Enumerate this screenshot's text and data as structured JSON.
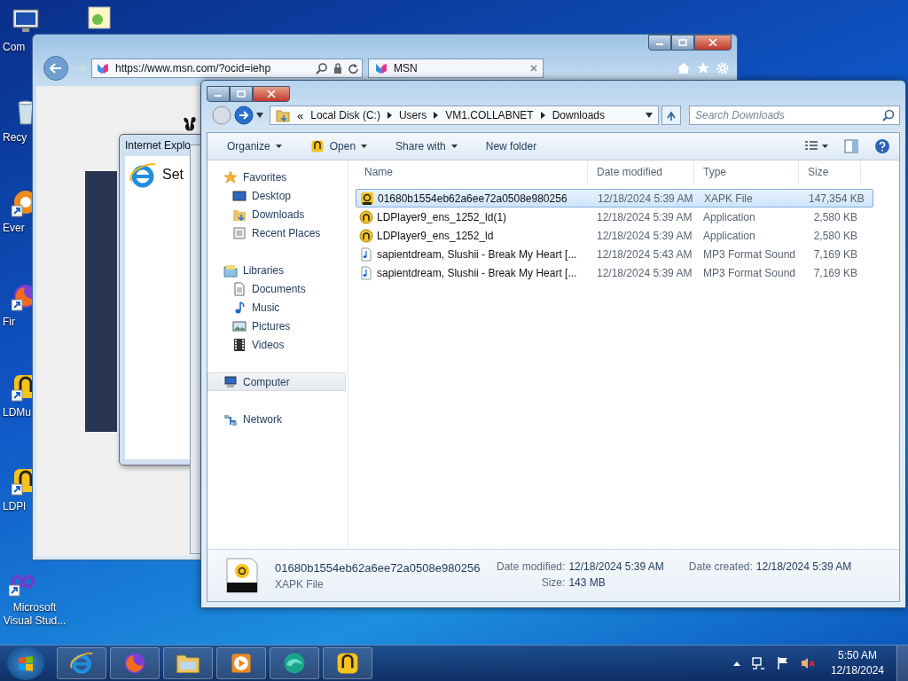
{
  "desktop_icons": [
    {
      "label": "Com"
    },
    {
      "label": "Recy"
    },
    {
      "label": "Ever"
    },
    {
      "label": "Fir"
    },
    {
      "label": "LDMu"
    },
    {
      "label": "LDPl"
    },
    {
      "label": "Microsoft Visual Stud..."
    }
  ],
  "browser": {
    "address": "https://www.msn.com/?ocid=iehp",
    "tab": "MSN",
    "dialog": {
      "title": "Internet Explo",
      "text": "Set"
    }
  },
  "explorer": {
    "breadcrumb_overflow": "«",
    "breadcrumb": [
      "Local Disk (C:)",
      "Users",
      "VM1.COLLABNET",
      "Downloads"
    ],
    "search": {
      "placeholder": "Search Downloads"
    },
    "toolbar": [
      {
        "label": "Organize",
        "kind": "menu"
      },
      {
        "label": "Open",
        "kind": "open"
      },
      {
        "label": "Share with",
        "kind": "menu"
      },
      {
        "label": "New folder",
        "kind": "plain"
      }
    ],
    "nav": [
      {
        "label": "Favorites",
        "selected": false,
        "children": [
          {
            "label": "Desktop",
            "selected": false
          },
          {
            "label": "Downloads",
            "selected": false
          },
          {
            "label": "Recent Places",
            "selected": false
          }
        ]
      },
      {
        "label": "Libraries",
        "selected": false,
        "children": [
          {
            "label": "Documents",
            "selected": false
          },
          {
            "label": "Music",
            "selected": false
          },
          {
            "label": "Pictures",
            "selected": false
          },
          {
            "label": "Videos",
            "selected": false
          }
        ]
      },
      {
        "label": "Computer",
        "selected": true
      },
      {
        "label": "Network",
        "selected": false
      }
    ],
    "columns": [
      "Name",
      "Date modified",
      "Type",
      "Size"
    ],
    "rows": [
      {
        "kind": "xapk",
        "name": "01680b1554eb62a6ee72a0508e980256",
        "date": "12/18/2024 5:39 AM",
        "type": "XAPK File",
        "size": "147,354 KB",
        "selected": true
      },
      {
        "kind": "app",
        "name": "LDPlayer9_ens_1252_ld(1)",
        "date": "12/18/2024 5:39 AM",
        "type": "Application",
        "size": "2,580 KB",
        "selected": false
      },
      {
        "kind": "app",
        "name": "LDPlayer9_ens_1252_ld",
        "date": "12/18/2024 5:39 AM",
        "type": "Application",
        "size": "2,580 KB",
        "selected": false
      },
      {
        "kind": "audio",
        "name": "sapientdream, Slushii - Break My Heart [...",
        "date": "12/18/2024 5:43 AM",
        "type": "MP3 Format Sound",
        "size": "7,169 KB",
        "selected": false
      },
      {
        "kind": "audio",
        "name": "sapientdream, Slushii - Break My Heart [...",
        "date": "12/18/2024 5:39 AM",
        "type": "MP3 Format Sound",
        "size": "7,169 KB",
        "selected": false
      }
    ],
    "details": {
      "name": "01680b1554eb62a6ee72a0508e980256",
      "type": "XAPK File",
      "modified_label": "Date modified:",
      "modified": "12/18/2024 5:39 AM",
      "created_label": "Date created:",
      "created": "12/18/2024 5:39 AM",
      "size_label": "Size:",
      "size": "143 MB"
    }
  },
  "taskbar": {
    "time": "5:50 AM",
    "date": "12/18/2024"
  }
}
